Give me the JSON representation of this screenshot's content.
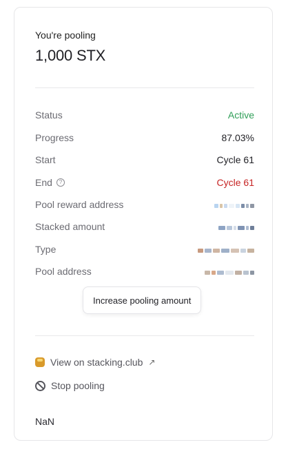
{
  "card": {
    "eyebrow": "You're pooling",
    "amount": "1,000 STX"
  },
  "details": [
    {
      "name": "status",
      "label": "Status",
      "value": "Active",
      "tone": "green"
    },
    {
      "name": "progress",
      "label": "Progress",
      "value": "87.03%",
      "tone": "default"
    },
    {
      "name": "start",
      "label": "Start",
      "value": "Cycle 61",
      "tone": "default"
    },
    {
      "name": "end",
      "label": "End",
      "value": "Cycle 61",
      "tone": "red",
      "has_help_icon": true
    },
    {
      "name": "pool-reward-address",
      "label": "Pool reward address",
      "value_redacted": true
    },
    {
      "name": "stacked-amount",
      "label": "Stacked amount",
      "value_redacted": true
    },
    {
      "name": "type",
      "label": "Type",
      "value_redacted": true
    },
    {
      "name": "pool-address",
      "label": "Pool address",
      "value_redacted": true
    }
  ],
  "actions": {
    "increase_label": "Increase pooling amount",
    "stacking_club_label": "View on stacking.club",
    "stop_label": "Stop pooling"
  },
  "footer": {
    "nan": "NaN"
  },
  "colors": {
    "green": "#2f9e57",
    "red": "#c62424",
    "label": "#6b6b72"
  },
  "icons": {
    "help": "question-circle-icon",
    "external": "external-arrow-icon",
    "stacking_club": "pancake-icon",
    "stop": "ban-icon"
  }
}
